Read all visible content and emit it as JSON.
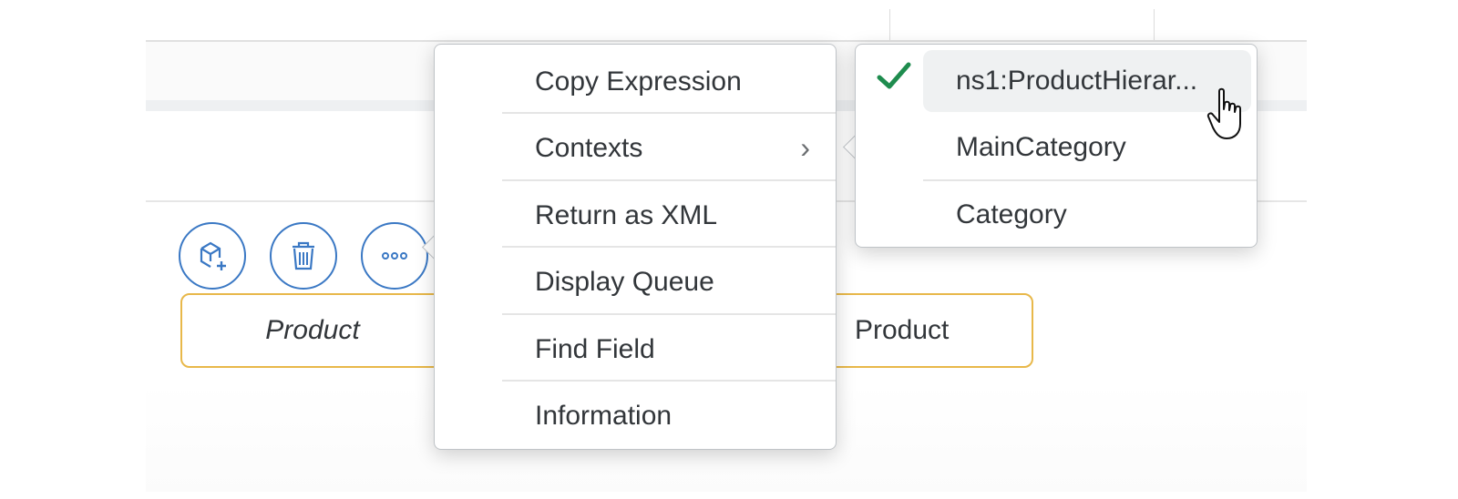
{
  "actions": {
    "add_icon": "add-node-icon",
    "delete_icon": "delete-icon",
    "more_icon": "more-options-icon"
  },
  "nodes": {
    "left": "Product",
    "right": "Product"
  },
  "context_menu": {
    "items": [
      {
        "label": "Copy Expression"
      },
      {
        "label": "Contexts",
        "submenu": true
      },
      {
        "label": "Return as XML"
      },
      {
        "label": "Display Queue"
      },
      {
        "label": "Find Field"
      },
      {
        "label": "Information"
      }
    ],
    "submenu_chevron": "›"
  },
  "contexts_submenu": {
    "items": [
      {
        "label": "ns1:ProductHierar...",
        "selected": true
      },
      {
        "label": "MainCategory"
      },
      {
        "label": "Category"
      }
    ]
  },
  "colors": {
    "accent_blue": "#3a78c4",
    "check_green": "#1e8c4e",
    "node_border": "#e8b84a"
  }
}
